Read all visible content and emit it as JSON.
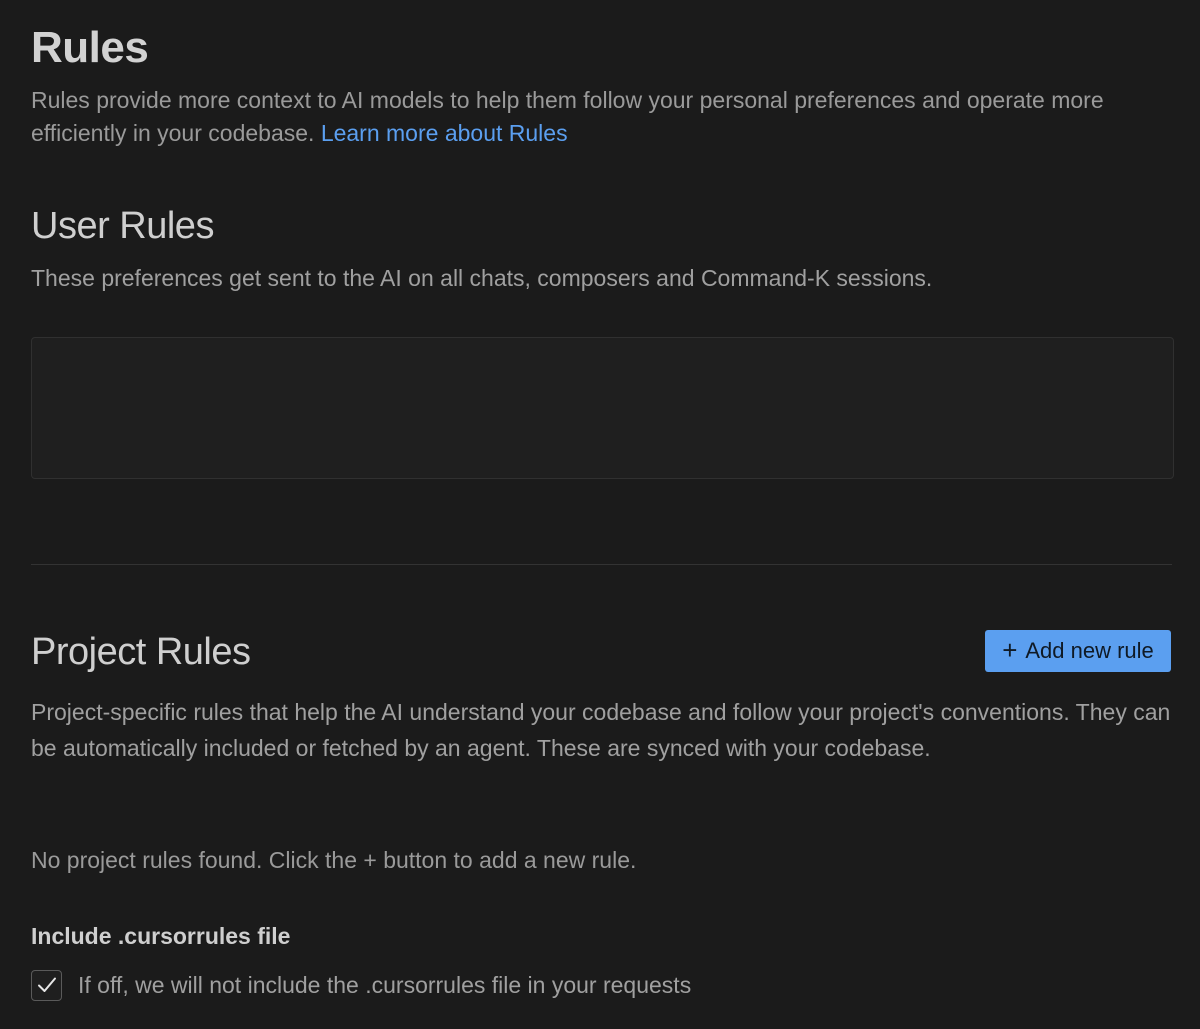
{
  "header": {
    "title": "Rules",
    "description": "Rules provide more context to AI models to help them follow your personal preferences and operate more efficiently in your codebase. ",
    "learn_more_link": "Learn more about Rules"
  },
  "user_rules": {
    "title": "User Rules",
    "description": "These preferences get sent to the AI on all chats, composers and Command-K sessions.",
    "input_value": ""
  },
  "project_rules": {
    "title": "Project Rules",
    "add_button_label": "Add new rule",
    "add_button_icon": "plus-icon",
    "description": "Project-specific rules that help the AI understand your codebase and follow your project's conventions. They can be automatically included or fetched by an agent. These are synced with your codebase.",
    "empty_message": "No project rules found. Click the + button to add a new rule."
  },
  "cursorrules": {
    "heading": "Include .cursorrules file",
    "checkbox_label": "If off, we will not include the .cursorrules file in your requests",
    "checked": true
  },
  "colors": {
    "background": "#1b1b1b",
    "accent": "#5b9ff0",
    "text_primary": "#d2d2d2",
    "text_secondary": "#9a9a9a"
  }
}
